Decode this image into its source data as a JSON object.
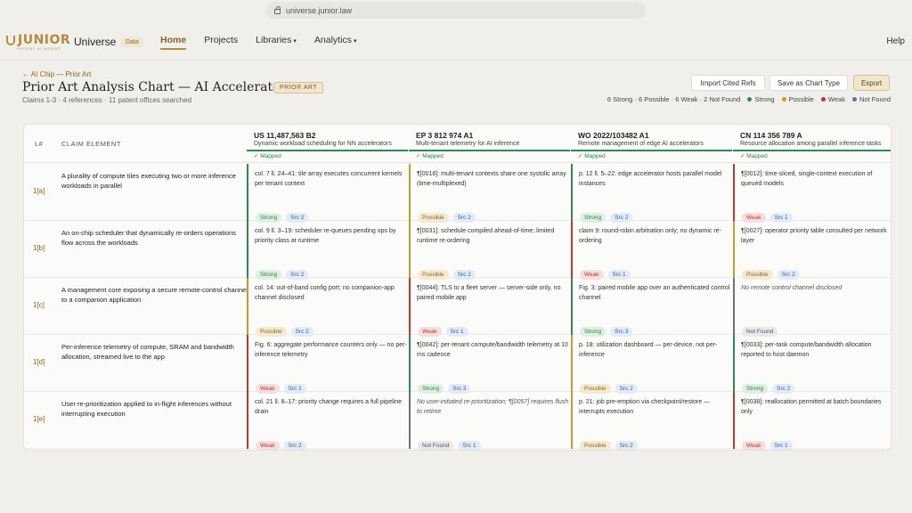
{
  "browser": {
    "url": "universe.junior.law"
  },
  "brand": {
    "logo": "JUNIOR",
    "logo_sub": "PATENT AI AGENT",
    "app": "Universe",
    "badge": "Data"
  },
  "nav": {
    "home": "Home",
    "projects": "Projects",
    "libraries": "Libraries",
    "analytics": "Analytics",
    "help": "Help"
  },
  "page": {
    "breadcrumb": "← AI Chip — Prior Art",
    "title": "Prior Art Analysis Chart — AI Accelerator",
    "badge": "PRIOR ART",
    "subtitle": "Claims 1-3 · 4 references · 11 patent offices searched"
  },
  "actions": {
    "import": "Import Cited Refs",
    "save": "Save as Chart Type",
    "export": "Export"
  },
  "summary": {
    "counts": "6 Strong · 6 Possible · 6 Weak · 2 Not Found",
    "legend": [
      {
        "label": "Strong",
        "color": "#2e8b57"
      },
      {
        "label": "Possible",
        "color": "#c99a2e"
      },
      {
        "label": "Weak",
        "color": "#c0392b"
      },
      {
        "label": "Not Found",
        "color": "#6b6f8a"
      }
    ]
  },
  "table": {
    "col_num": "L#",
    "col_claim": "CLAIM ELEMENT",
    "mapped_label": "✓ Mapped",
    "references": [
      {
        "id": "US 11,487,563 B2",
        "desc": "Dynamic workload scheduling for NN accelerators"
      },
      {
        "id": "EP 3 812 974 A1",
        "desc": "Multi-tenant telemetry for AI inference"
      },
      {
        "id": "WO 2022/103482 A1",
        "desc": "Remote management of edge AI accelerators"
      },
      {
        "id": "CN 114 356 789 A",
        "desc": "Resource allocation among parallel inference tasks"
      }
    ],
    "rows": [
      {
        "num": "1[a]",
        "claim": "A plurality of compute tiles executing two or more inference workloads in parallel",
        "cells": [
          {
            "text": "col. 7 ll. 24–41: tile array executes concurrent kernels per tenant context",
            "rating": "Strong",
            "src": "Src 2",
            "cls": "strong"
          },
          {
            "text": "¶[0018]: multi-tenant contexts share one systolic array (time-multiplexed)",
            "rating": "Possible",
            "src": "Src 2",
            "cls": "possible"
          },
          {
            "text": "p. 12 ll. 5–22: edge accelerator hosts parallel model instances",
            "rating": "Strong",
            "src": "Src 2",
            "cls": "strong"
          },
          {
            "text": "¶[0012]: time-sliced, single-context execution of queued models",
            "rating": "Weak",
            "src": "Src 1",
            "cls": "weak"
          }
        ]
      },
      {
        "num": "1[b]",
        "claim": "An on-chip scheduler that dynamically re-orders operations flow across the workloads",
        "cells": [
          {
            "text": "col. 9 ll. 3–19: scheduler re-queues pending ops by priority class at runtime",
            "rating": "Strong",
            "src": "Src 2",
            "cls": "strong"
          },
          {
            "text": "¶[0031]: schedule compiled ahead-of-time; limited runtime re-ordering",
            "rating": "Possible",
            "src": "Src 2",
            "cls": "possible"
          },
          {
            "text": "claim 9: round-robin arbitration only; no dynamic re-ordering",
            "rating": "Weak",
            "src": "Src 1",
            "cls": "weak"
          },
          {
            "text": "¶[0027]: operator priority table consulted per network layer",
            "rating": "Possible",
            "src": "Src 2",
            "cls": "possible"
          }
        ]
      },
      {
        "num": "1[c]",
        "claim": "A management core exposing a secure remote-control channel to a companion application",
        "cells": [
          {
            "text": "col. 14: out-of-band config port; no companion-app channel disclosed",
            "rating": "Possible",
            "src": "Src 2",
            "cls": "possible"
          },
          {
            "text": "¶[0044]: TLS to a fleet server — server-side only, no paired mobile app",
            "rating": "Weak",
            "src": "Src 1",
            "cls": "weak"
          },
          {
            "text": "Fig. 3: paired mobile app over an authenticated control channel",
            "rating": "Strong",
            "src": "Src 3",
            "cls": "strong"
          },
          {
            "text": "No remote control channel disclosed",
            "rating": "Not Found",
            "src": "",
            "cls": "notfound",
            "nf": true
          }
        ]
      },
      {
        "num": "1[d]",
        "claim": "Per-inference telemetry of compute, SRAM and bandwidth allocation, streamed live to the app",
        "cells": [
          {
            "text": "Fig. 6: aggregate performance counters only — no per-inference telemetry",
            "rating": "Weak",
            "src": "Src 1",
            "cls": "weak"
          },
          {
            "text": "¶[0042]: per-tenant compute/bandwidth telemetry at 10 ms cadence",
            "rating": "Strong",
            "src": "Src 3",
            "cls": "strong"
          },
          {
            "text": "p. 18: utilization dashboard — per-device, not per-inference",
            "rating": "Possible",
            "src": "Src 2",
            "cls": "possible"
          },
          {
            "text": "¶[0033]: per-task compute/bandwidth allocation reported to host daemon",
            "rating": "Strong",
            "src": "Src 2",
            "cls": "strong"
          }
        ]
      },
      {
        "num": "1[e]",
        "claim": "User re-prioritization applied to in-flight inferences without interrupting execution",
        "cells": [
          {
            "text": "col. 21 ll. 8–17: priority change requires a full pipeline drain",
            "rating": "Weak",
            "src": "Src 2",
            "cls": "weak"
          },
          {
            "text": "No user-initiated re-prioritization; ¶[0057] requires flush to retime",
            "rating": "Not Found",
            "src": "Src 1",
            "cls": "notfound",
            "nf": true
          },
          {
            "text": "p. 21: job pre-emption via checkpoint/restore — interrupts execution",
            "rating": "Possible",
            "src": "Src 2",
            "cls": "possible"
          },
          {
            "text": "¶[0038]: reallocation permitted at batch boundaries only",
            "rating": "Weak",
            "src": "Src 1",
            "cls": "weak"
          }
        ]
      }
    ]
  }
}
